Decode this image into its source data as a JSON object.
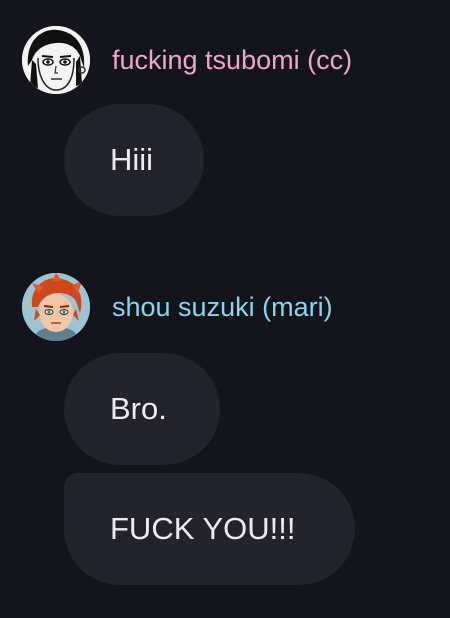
{
  "messages": [
    {
      "username": "fucking tsubomi (cc)",
      "username_color": "#f2a4d0",
      "avatar_icon": "tsubomi-avatar",
      "bubbles": [
        "Hiii"
      ]
    },
    {
      "username": "shou suzuki (mari)",
      "username_color": "#86d6ee",
      "avatar_icon": "shou-avatar",
      "bubbles": [
        "Bro.",
        "FUCK YOU!!!"
      ]
    }
  ],
  "theme": {
    "background": "#14141c",
    "bubble_background": "#23232e",
    "text_color": "#ececf0"
  }
}
